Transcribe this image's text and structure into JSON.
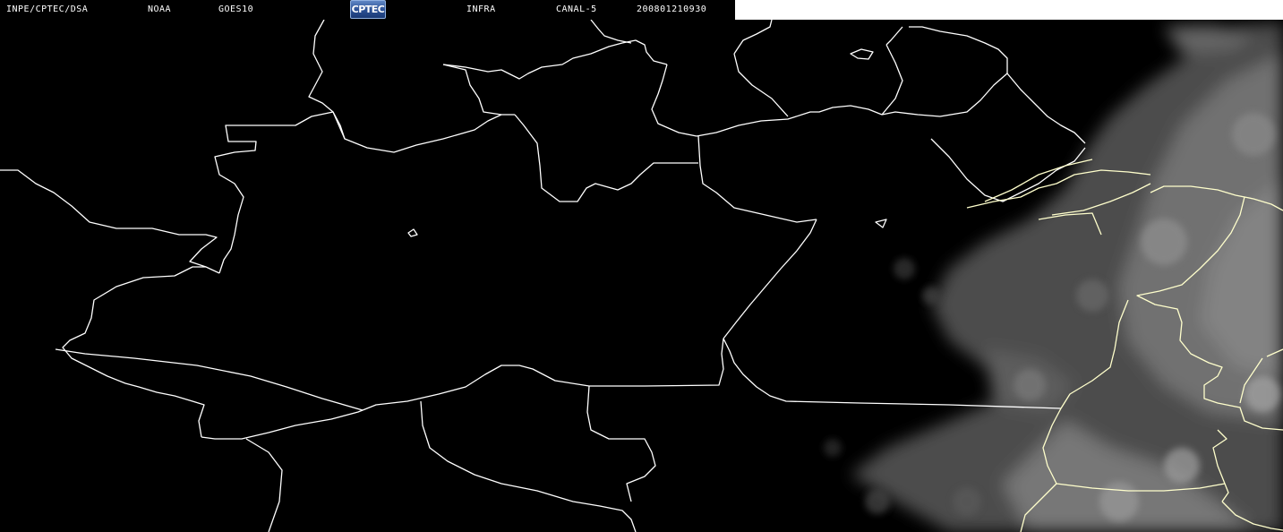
{
  "header": {
    "source": "INPE/CPTEC/DSA",
    "agency": "NOAA",
    "satellite": "GOES10",
    "logo_text": "CPTEC",
    "band": "INFRA",
    "channel": "CANAL-5",
    "timestamp": "200801210930"
  },
  "colors": {
    "background": "#000000",
    "borders": "#ffffff",
    "coast_borders": "#ffffcc",
    "clouds": "#8a8a8a",
    "header_strip_right": "#ffffff"
  }
}
